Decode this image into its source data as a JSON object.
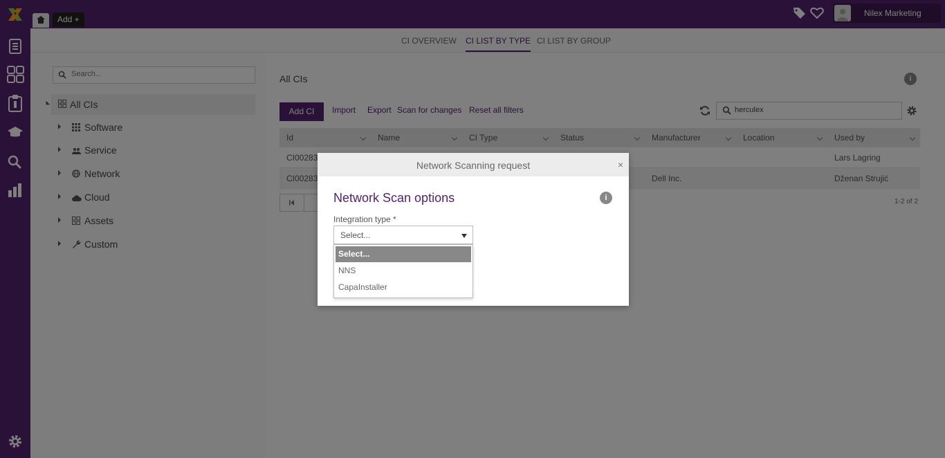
{
  "topbar": {
    "add_label": "Add +",
    "user_name": "Nilex Marketing"
  },
  "tabs": [
    {
      "label": "CI OVERVIEW",
      "active": false
    },
    {
      "label": "CI LIST BY TYPE",
      "active": true
    },
    {
      "label": "CI LIST BY GROUP",
      "active": false
    }
  ],
  "left": {
    "search_placeholder": "Search...",
    "root_label": "All CIs",
    "items": [
      {
        "label": "Software",
        "icon": "grid-icon"
      },
      {
        "label": "Service",
        "icon": "users-icon"
      },
      {
        "label": "Network",
        "icon": "globe-icon"
      },
      {
        "label": "Cloud",
        "icon": "cloud-icon"
      },
      {
        "label": "Assets",
        "icon": "grid-icon"
      },
      {
        "label": "Custom",
        "icon": "wrench-icon"
      }
    ]
  },
  "main": {
    "title": "All CIs",
    "add_ci": "Add CI",
    "import": "Import",
    "export": "Export",
    "scan": "Scan for changes",
    "reset": "Reset all filters",
    "search_value": "herculex",
    "columns": [
      "Id",
      "Name",
      "CI Type",
      "Status",
      "Manufacturer",
      "Location",
      "Used by"
    ],
    "rows": [
      {
        "id": "CI00283",
        "name": "",
        "type": "",
        "status": "",
        "manufacturer": "",
        "location": "",
        "used_by": "Lars Lagring"
      },
      {
        "id": "CI00283",
        "name": "",
        "type": "",
        "status": "",
        "manufacturer": "Dell Inc.",
        "location": "",
        "used_by": "Dženan Strujić"
      }
    ],
    "count": "1-2 of 2"
  },
  "modal": {
    "title": "Network Scanning request",
    "close": "×",
    "heading": "Network Scan options",
    "field_label": "Integration type *",
    "selected": "Select...",
    "options": [
      "Select...",
      "NNS",
      "CapaInstaller"
    ]
  },
  "colors": {
    "brand": "#55226f"
  }
}
